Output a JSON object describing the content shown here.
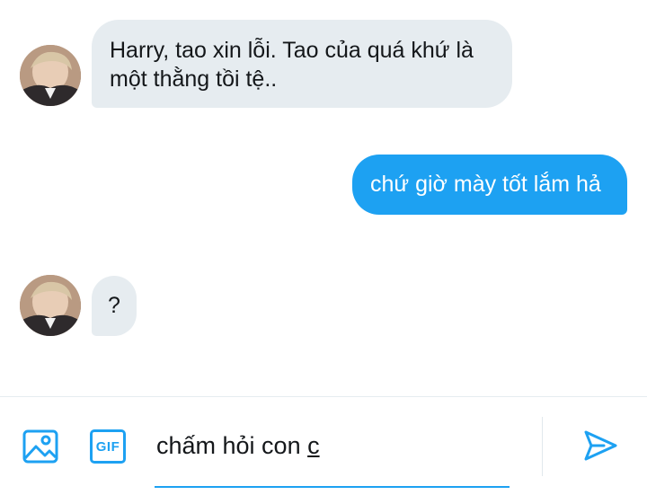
{
  "conversation": {
    "messages": [
      {
        "direction": "incoming",
        "text_line1": "Harry, tao xin lỗi. Tao của quá khứ là",
        "text_line2": "một thằng tồi tệ.."
      },
      {
        "direction": "outgoing",
        "text": "chứ giờ mày tốt lắm hả"
      },
      {
        "direction": "incoming",
        "text": "?"
      }
    ]
  },
  "composer": {
    "input_value_prefix": "chấm hỏi con ",
    "input_value_composing": "c",
    "icons": {
      "media": "image-icon",
      "gif": "gif-icon",
      "send": "send-icon"
    },
    "gif_label": "GIF",
    "accent_color": "#1da1f2"
  },
  "colors": {
    "incoming_bubble": "#e6ecf0",
    "outgoing_bubble": "#1da1f2",
    "text": "#14171a"
  }
}
